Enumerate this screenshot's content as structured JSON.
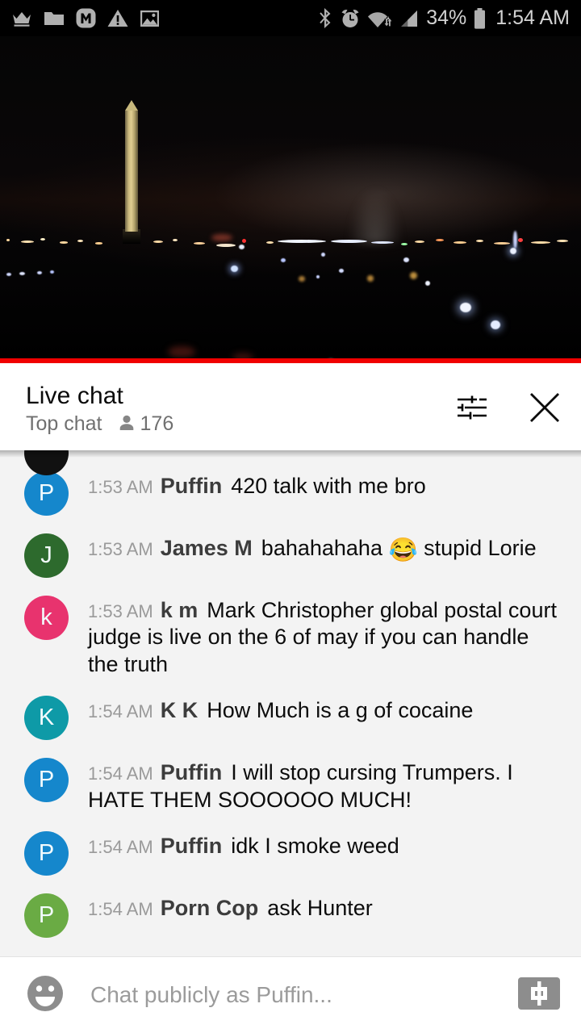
{
  "statusbar": {
    "left_icons": [
      "crown-icon",
      "folder-icon",
      "m-app-icon",
      "warning-triangle-icon",
      "image-icon"
    ],
    "right_icons": [
      "bluetooth-icon",
      "alarm-clock-icon",
      "wifi-icon",
      "cell-signal-icon",
      "battery-icon"
    ],
    "battery_percent": "34%",
    "time": "1:54 AM"
  },
  "video": {
    "description": "Washington Monument at night live stream"
  },
  "chat_header": {
    "title": "Live chat",
    "mode": "Top chat",
    "viewer_count": "176",
    "settings_icon": "tune-sliders-icon",
    "close_icon": "close-x-icon"
  },
  "messages": [
    {
      "time": "1:53 AM",
      "author": "Puffin",
      "text": "420 talk with me bro",
      "initial": "P",
      "color": "#1587cc"
    },
    {
      "time": "1:53 AM",
      "author": "James M",
      "text_before": "bahahahaha ",
      "emoji": "😂",
      "text_after": " stupid Lorie",
      "initial": "J",
      "color": "#2d6a2d"
    },
    {
      "time": "1:53 AM",
      "author": "k m",
      "text": "Mark Christopher global postal court judge is live on the 6 of may if you can handle the truth",
      "initial": "k",
      "color": "#e8336e"
    },
    {
      "time": "1:54 AM",
      "author": "K K",
      "text": "How Much is a g of cocaine",
      "initial": "K",
      "color": "#0e9aa7"
    },
    {
      "time": "1:54 AM",
      "author": "Puffin",
      "text": "I will stop cursing Trumpers. I HATE THEM SOOOOOO MUCH!",
      "initial": "P",
      "color": "#1587cc"
    },
    {
      "time": "1:54 AM",
      "author": "Puffin",
      "text": "idk I smoke weed",
      "initial": "P",
      "color": "#1587cc"
    },
    {
      "time": "1:54 AM",
      "author": "Porn Cop",
      "text": "ask Hunter",
      "initial": "P",
      "color": "#6aab44"
    }
  ],
  "input_bar": {
    "emoji_icon": "emoji-smiley-icon",
    "placeholder": "Chat publicly as Puffin...",
    "superchat_icon": "super-chat-dollar-icon"
  },
  "colors": {
    "accent_red": "#f00000",
    "chat_background": "#f3f3f3"
  }
}
